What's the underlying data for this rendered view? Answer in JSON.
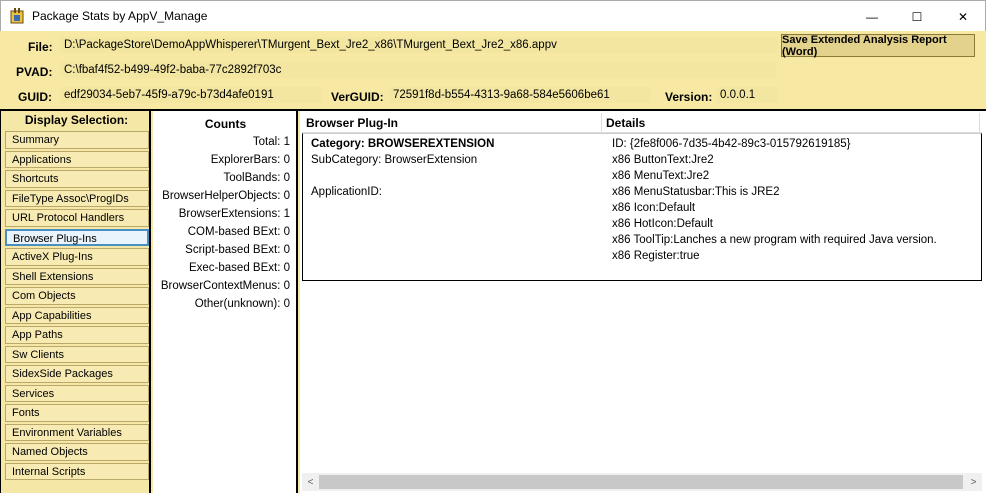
{
  "window": {
    "title": "Package Stats by AppV_Manage",
    "minimize_glyph": "—",
    "maximize_glyph": "☐",
    "close_glyph": "✕"
  },
  "header": {
    "file_label": "File:",
    "file_value": "D:\\PackageStore\\DemoAppWhisperer\\TMurgent_Bext_Jre2_x86\\TMurgent_Bext_Jre2_x86.appv",
    "pvad_label": "PVAD:",
    "pvad_value": "C:\\fbaf4f52-b499-49f2-baba-77c2892f703c",
    "guid_label": "GUID:",
    "guid_value": "edf29034-5eb7-45f9-a79c-b73d4afe0191",
    "verguid_label": "VerGUID:",
    "verguid_value": "72591f8d-b554-4313-9a68-584e5606be61",
    "version_label": "Version:",
    "version_value": "0.0.0.1",
    "save_button": "Save Extended Analysis Report (Word)"
  },
  "sidebar": {
    "title": "Display Selection:",
    "items": [
      {
        "label": "Summary"
      },
      {
        "label": "Applications"
      },
      {
        "label": "Shortcuts"
      },
      {
        "label": "FileType Assoc\\ProgIDs"
      },
      {
        "label": "URL Protocol Handlers"
      },
      {
        "label": "Browser Plug-Ins"
      },
      {
        "label": "ActiveX Plug-Ins"
      },
      {
        "label": "Shell Extensions"
      },
      {
        "label": "Com Objects"
      },
      {
        "label": "App Capabilities"
      },
      {
        "label": "App Paths"
      },
      {
        "label": "Sw Clients"
      },
      {
        "label": "SidexSide Packages"
      },
      {
        "label": "Services"
      },
      {
        "label": "Fonts"
      },
      {
        "label": "Environment Variables"
      },
      {
        "label": "Named Objects"
      },
      {
        "label": "Internal Scripts"
      }
    ],
    "selected": "Browser Plug-Ins"
  },
  "counts": {
    "title": "Counts",
    "rows": [
      {
        "label": "Total:",
        "value": "1"
      },
      {
        "label": "ExplorerBars:",
        "value": "0"
      },
      {
        "label": "ToolBands:",
        "value": "0"
      },
      {
        "label": "BrowserHelperObjects:",
        "value": "0"
      },
      {
        "label": "BrowserExtensions:",
        "value": "1"
      },
      {
        "label": "COM-based BExt:",
        "value": "0"
      },
      {
        "label": "Script-based BExt:",
        "value": "0"
      },
      {
        "label": "Exec-based BExt:",
        "value": "0"
      },
      {
        "label": "BrowserContextMenus:",
        "value": "0"
      },
      {
        "label": "Other(unknown):",
        "value": "0"
      }
    ]
  },
  "grid": {
    "columns": {
      "plugin": "Browser Plug-In",
      "details": "Details"
    },
    "row": {
      "category": "Category: BROWSEREXTENSION",
      "subcategory": "SubCategory: BrowserExtension",
      "application_id": "ApplicationID:",
      "details": [
        "ID: {2fe8f006-7d35-4b42-89c3-015792619185}",
        "x86 ButtonText:Jre2",
        "x86 MenuText:Jre2",
        "x86 MenuStatusbar:This is JRE2",
        "x86 Icon:Default",
        "x86 HotIcon:Default",
        "x86 ToolTip:Lanches a new program with required Java version.",
        "x86 Register:true"
      ]
    }
  },
  "scrollbar": {
    "left_arrow": "<",
    "right_arrow": ">"
  }
}
